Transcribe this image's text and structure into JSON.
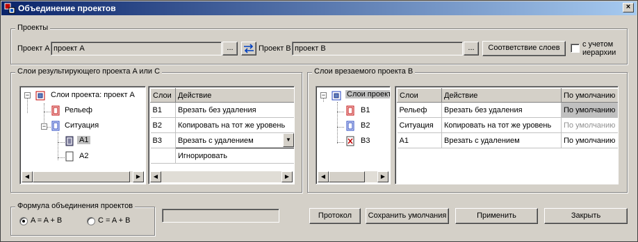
{
  "window": {
    "title": "Объединение проектов",
    "close_glyph": "×"
  },
  "projects": {
    "legend": "Проекты",
    "project_a_label": "Проект A",
    "project_a_value": "проект A",
    "project_b_label": "Проект B",
    "project_b_value": "проект B",
    "browse_label": "...",
    "layer_match_button": "Соответствие слоев",
    "hierarchy_checkbox": {
      "label_line1": "с учетом",
      "label_line2": "иерархии",
      "checked": false
    }
  },
  "result_layers": {
    "legend": "Слои результирующего проекта A или C",
    "tree": {
      "root": "Слои проекта: проект A",
      "items": [
        "Рельеф",
        "Ситуация",
        "A1",
        "A2"
      ]
    },
    "grid": {
      "columns": [
        "Слои",
        "Действие"
      ],
      "rows": [
        {
          "layer": "B1",
          "action": "Врезать без удаления"
        },
        {
          "layer": "B2",
          "action": "Копировать на тот же уровень"
        },
        {
          "layer": "B3",
          "action": "Врезать с удалением"
        },
        {
          "layer": "",
          "action": "Игнорировать"
        }
      ]
    }
  },
  "insert_layers": {
    "legend": "Слои врезаемого проекта B",
    "tree": {
      "root": "Слои проект",
      "items": [
        "B1",
        "B2",
        "B3"
      ]
    },
    "grid": {
      "columns": [
        "Слои",
        "Действие",
        "По умолчанию"
      ],
      "rows": [
        {
          "layer": "Рельеф",
          "action": "Врезать без удаления",
          "default": "По умолчанию"
        },
        {
          "layer": "Ситуация",
          "action": "Копировать на тот же уровень",
          "default": "По умолчанию"
        },
        {
          "layer": "A1",
          "action": "Врезать с удалением",
          "default": "По умолчанию"
        }
      ]
    }
  },
  "formula": {
    "legend": "Формула объединения проектов",
    "option_a": "A = A + B",
    "option_c": "C = A + B",
    "selected": "A"
  },
  "buttons": {
    "protocol": "Протокол",
    "save_defaults": "Сохранить умолчания",
    "apply": "Применить",
    "close": "Закрыть"
  },
  "colors": {
    "title_start": "#0a246a",
    "title_end": "#a6caf0",
    "face": "#d4d0c8",
    "selection": "#c0c0c0"
  }
}
